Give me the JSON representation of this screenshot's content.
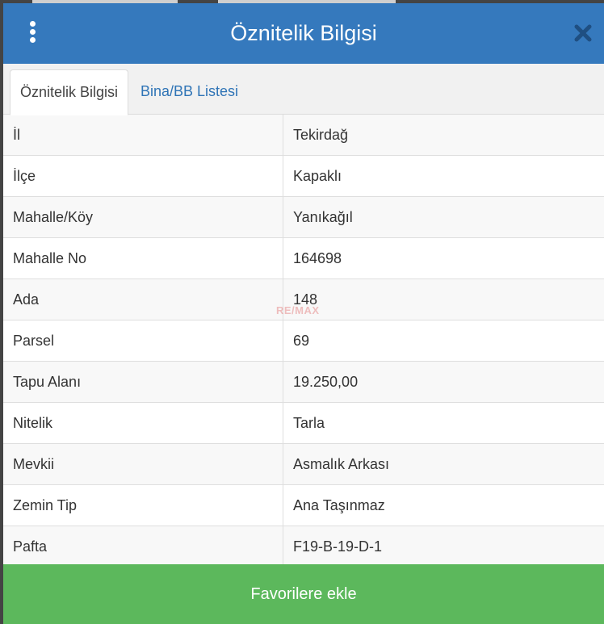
{
  "header": {
    "title": "Öznitelik Bilgisi",
    "menu_icon": "vertical-dots-icon",
    "close_icon": "close-icon",
    "color": "#3579bd"
  },
  "tabs": [
    {
      "label": "Öznitelik Bilgisi",
      "active": true
    },
    {
      "label": "Bina/BB Listesi",
      "active": false
    }
  ],
  "attributes": [
    {
      "key": "İl",
      "value": "Tekirdağ"
    },
    {
      "key": "İlçe",
      "value": "Kapaklı"
    },
    {
      "key": "Mahalle/Köy",
      "value": "Yanıkağıl"
    },
    {
      "key": "Mahalle No",
      "value": "164698"
    },
    {
      "key": "Ada",
      "value": "148"
    },
    {
      "key": "Parsel",
      "value": "69"
    },
    {
      "key": "Tapu Alanı",
      "value": "19.250,00"
    },
    {
      "key": "Nitelik",
      "value": "Tarla"
    },
    {
      "key": "Mevkii",
      "value": "Asmalık Arkası"
    },
    {
      "key": "Zemin Tip",
      "value": "Ana Taşınmaz"
    },
    {
      "key": "Pafta",
      "value": "F19-B-19-D-1"
    }
  ],
  "watermark": "RE/MAX",
  "footer": {
    "favorite_label": "Favorilere ekle",
    "color": "#5cb85c"
  }
}
